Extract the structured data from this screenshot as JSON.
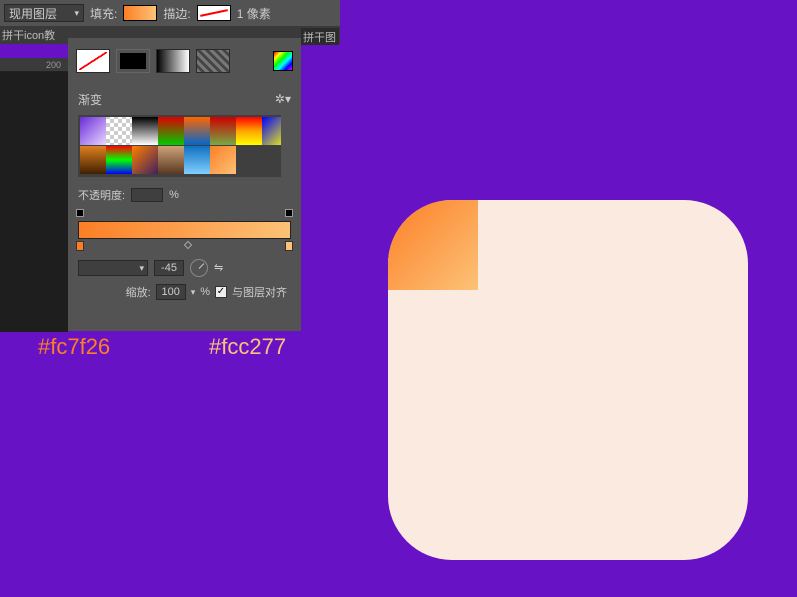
{
  "topbar": {
    "layer_mode": "现用图层",
    "fill_label": "填充:",
    "stroke_label": "描边:",
    "stroke_size": "1 像素"
  },
  "tabs": {
    "left_tab": "拼干icon教",
    "right_tab": "拼干图"
  },
  "ruler": {
    "tick": "200"
  },
  "gradient": {
    "title": "渐变",
    "opacity_label": "不透明度:",
    "opacity_unit": "%",
    "angle_value": "-45",
    "zoom_label": "缩放:",
    "zoom_value": "100",
    "zoom_unit": "%",
    "align_label": "与图层对齐"
  },
  "hex": {
    "c1": "#fc7f26",
    "c2": "#fcc277"
  }
}
